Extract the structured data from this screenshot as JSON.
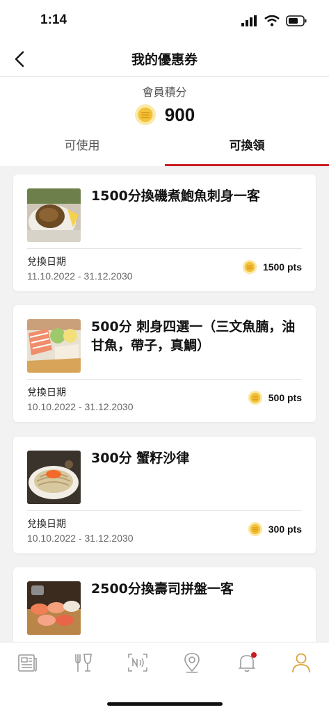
{
  "status": {
    "time": "1:14"
  },
  "nav": {
    "title": "我的優惠券"
  },
  "points": {
    "label": "會員積分",
    "value": "900"
  },
  "tabs": [
    {
      "label": "可使用",
      "active": false
    },
    {
      "label": "可換領",
      "active": true
    }
  ],
  "cards": [
    {
      "title": "1500分換磯煮鮑魚刺身一客",
      "date_label": "兌換日期",
      "date_range": "11.10.2022 - 31.12.2030",
      "points": "1500 pts"
    },
    {
      "title": "500分 刺身四選一（三文魚腩，油甘魚，帶子，真鯛）",
      "date_label": "兌換日期",
      "date_range": "10.10.2022 - 31.12.2030",
      "points": "500 pts"
    },
    {
      "title": "300分 蟹籽沙律",
      "date_label": "兌換日期",
      "date_range": "10.10.2022 - 31.12.2030",
      "points": "300 pts"
    },
    {
      "title": "2500分換壽司拼盤一客"
    }
  ],
  "bottom_nav": [
    {
      "icon": "news-icon"
    },
    {
      "icon": "menu-fork-glass-icon"
    },
    {
      "icon": "nfc-scan-icon"
    },
    {
      "icon": "location-pin-icon"
    },
    {
      "icon": "notification-bell-icon",
      "badge": true
    },
    {
      "icon": "profile-icon",
      "active": true
    }
  ],
  "colors": {
    "accent": "#c81e24",
    "coin": "#f2c23a",
    "active_icon": "#d9a233"
  }
}
